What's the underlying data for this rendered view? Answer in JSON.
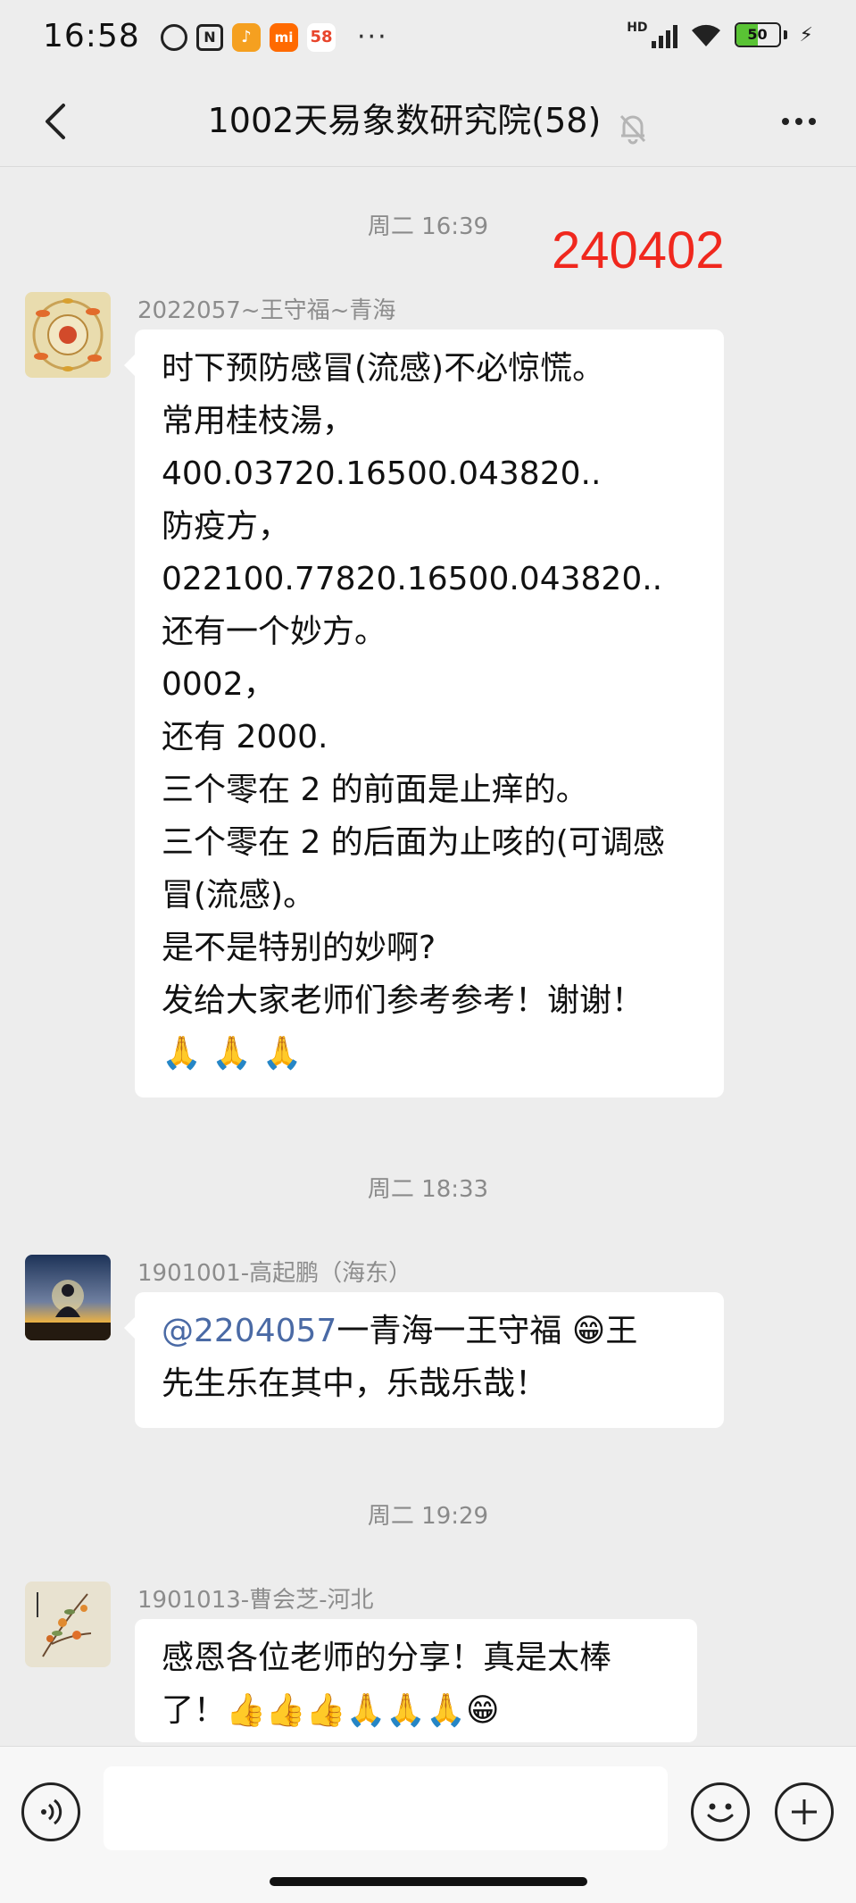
{
  "status_bar": {
    "time": "16:58",
    "app_icon_58": "58",
    "app_icon_mi": "mi",
    "more": "···",
    "network": "HD",
    "battery": "50",
    "icons": [
      "alarm-icon",
      "nfc-icon",
      "app-icon",
      "mi-app-icon",
      "58-app-icon",
      "signal-icon",
      "wifi-icon",
      "battery-icon",
      "charging-icon"
    ]
  },
  "header": {
    "title": "1002天易象数研究院(58)",
    "icons": [
      "back-icon",
      "mute-bell-icon",
      "more-icon"
    ]
  },
  "chat": {
    "date_label": "240402",
    "messages": [
      {
        "time": "周二 16:39",
        "sender": "2022057~王守福~青海",
        "lines": [
          "时下预防感冒(流感)不必惊慌。",
          "常用桂枝湯，",
          "400.03720.16500.043820..",
          "防疫方，",
          "022100.77820.16500.043820..",
          "还有一个妙方。",
          "0002，",
          "还有 2000.",
          "三个零在 2 的前面是止痒的。",
          "三个零在 2 的后面为止咳的(可调感",
          "冒(流感)。",
          "是不是特别的妙啊?",
          "发给大家老师们参考参考！谢谢！",
          "🙏 🙏 🙏"
        ]
      },
      {
        "time": "周二 18:33",
        "sender": "1901001-高起鹏（海东）",
        "mention": "@2204057",
        "line1_rest": "一青海一王守福 😁王",
        "line2": "先生乐在其中，乐哉乐哉！"
      },
      {
        "time": "周二 19:29",
        "sender": "1901013-曹会芝-河北",
        "line1": "感恩各位老师的分享！真是太棒",
        "line2": "了！👍👍👍🙏🙏🙏😁"
      }
    ]
  },
  "input_bar": {
    "icons": [
      "voice-icon",
      "emoji-icon",
      "plus-icon"
    ],
    "value": ""
  },
  "colors": {
    "background": "#ededed",
    "bubble": "#ffffff",
    "date_stamp": "#f0281e",
    "mention": "#4a6aa5"
  }
}
